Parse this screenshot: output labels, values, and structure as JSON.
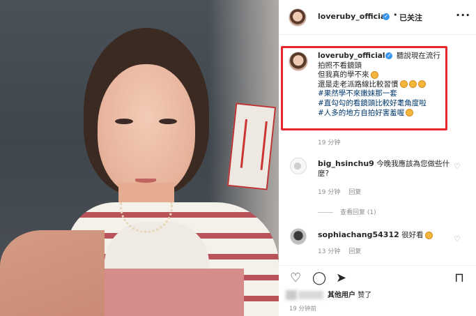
{
  "post_header": {
    "username": "loveruby_official",
    "verified_glyph": "✓",
    "separator": "•",
    "follow_status": "已关注",
    "more_glyph": "···"
  },
  "caption": {
    "username": "loveruby_official",
    "line1": "聽說現在流行拍照不看鏡頭",
    "line2": "但我真的學不來",
    "line3": "還是走老派路線比較習慣",
    "tags": [
      "#果然學不來嫩妹那一套",
      "#直勾勾的看鏡頭比較好耄角度啦",
      "#人多的地方自拍好害羞喔"
    ],
    "time": "19 分钟",
    "highlight_color": "#e5262b"
  },
  "comments": [
    {
      "username": "big_hsinchu9",
      "text": "今晚我應該為您做些什麼?",
      "time": "19 分钟",
      "reply": "回复"
    },
    {
      "username": "sophiachang54312",
      "text": "很好看",
      "time": "13 分钟",
      "reply": "回复"
    }
  ],
  "view_replies": "查看回复 (1)",
  "icons": {
    "heart": "♡",
    "comment": "◯",
    "share": "➤",
    "save": "⊓"
  },
  "likes": {
    "others": "其他用户",
    "liked": "赞了"
  },
  "post_time": "19 分钟前",
  "colors": {
    "link": "#00376b",
    "verified": "#3897f0",
    "muted": "#8e8e8e"
  }
}
